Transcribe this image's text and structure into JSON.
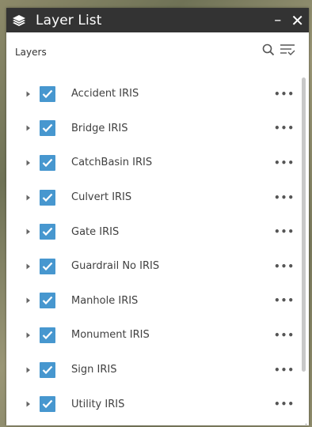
{
  "window": {
    "title": "Layer List",
    "minimize_label": "–",
    "close_label": "✕"
  },
  "toolbar": {
    "label": "Layers",
    "search_icon": "search-icon",
    "filter_icon": "filter-list-icon"
  },
  "accent_color": "#4797cf",
  "layers": [
    {
      "label": "Accident IRIS",
      "checked": true,
      "more": "•••"
    },
    {
      "label": "Bridge IRIS",
      "checked": true,
      "more": "•••"
    },
    {
      "label": "CatchBasin IRIS",
      "checked": true,
      "more": "•••"
    },
    {
      "label": "Culvert IRIS",
      "checked": true,
      "more": "•••"
    },
    {
      "label": "Gate IRIS",
      "checked": true,
      "more": "•••"
    },
    {
      "label": "Guardrail No IRIS",
      "checked": true,
      "more": "•••"
    },
    {
      "label": "Manhole IRIS",
      "checked": true,
      "more": "•••"
    },
    {
      "label": "Monument IRIS",
      "checked": true,
      "more": "•••"
    },
    {
      "label": "Sign IRIS",
      "checked": true,
      "more": "•••"
    },
    {
      "label": "Utility IRIS",
      "checked": true,
      "more": "•••"
    }
  ]
}
